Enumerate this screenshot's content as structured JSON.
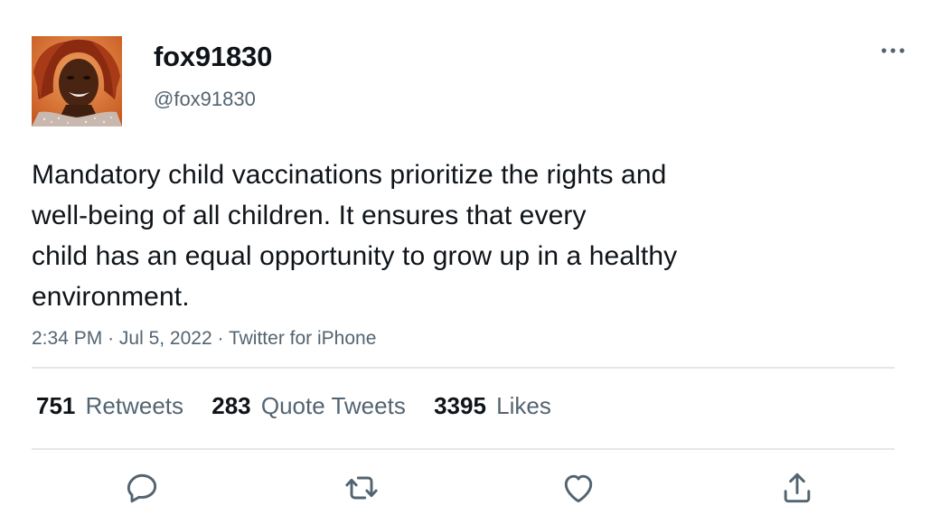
{
  "user": {
    "display_name": "fox91830",
    "handle": "@fox91830",
    "avatar_icon": "profile-photo"
  },
  "tweet": {
    "text_lines": [
      "Mandatory child vaccinations prioritize the rights and",
      "well-being of all children. It ensures that every",
      "child has an equal opportunity to grow up in a healthy",
      "environment."
    ],
    "time": "2:34 PM",
    "separator": "·",
    "date": "Jul 5, 2022",
    "source": "Twitter for iPhone"
  },
  "stats": {
    "retweets": {
      "count": "751",
      "label": "Retweets"
    },
    "quote_tweets": {
      "count": "283",
      "label": "Quote Tweets"
    },
    "likes": {
      "count": "3395",
      "label": "Likes"
    }
  },
  "actions": {
    "reply_icon": "reply-icon",
    "retweet_icon": "retweet-icon",
    "like_icon": "heart-icon",
    "share_icon": "share-icon"
  },
  "colors": {
    "text_primary": "#0f1419",
    "text_secondary": "#536471",
    "divider": "#e4e7ea",
    "icon": "#536471"
  }
}
